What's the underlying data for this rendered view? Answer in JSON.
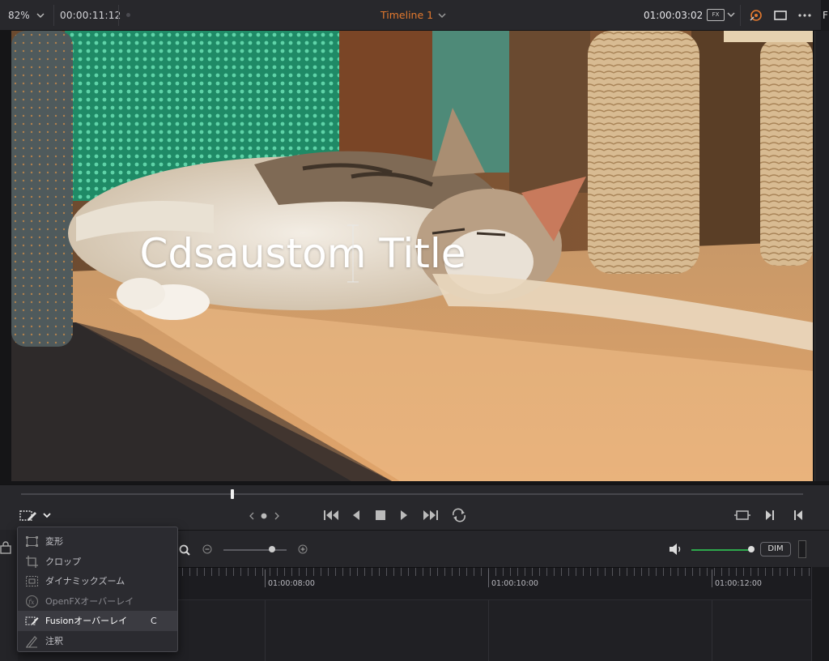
{
  "topbar": {
    "zoom": "82%",
    "source_timecode": "00:00:11:12",
    "timeline_name": "Timeline 1",
    "record_timecode": "01:00:03:02",
    "fx_label": "FX",
    "edge_label": "F"
  },
  "viewer": {
    "title_text": "Cdsaustom Title"
  },
  "transport": {
    "playhead_fraction": 0.27
  },
  "timeline_toolbar": {
    "dim_label": "DIM"
  },
  "ruler": {
    "labels": [
      "01:00:08:00",
      "01:00:10:00",
      "01:00:12:00"
    ]
  },
  "overlay_menu": {
    "items": [
      {
        "label": "変形",
        "icon": "transform-icon",
        "state": "normal",
        "shortcut": ""
      },
      {
        "label": "クロップ",
        "icon": "crop-icon",
        "state": "normal",
        "shortcut": ""
      },
      {
        "label": "ダイナミックズーム",
        "icon": "dynamic-zoom-icon",
        "state": "normal",
        "shortcut": ""
      },
      {
        "label": "OpenFXオーバーレイ",
        "icon": "openfx-icon",
        "state": "disabled",
        "shortcut": ""
      },
      {
        "label": "Fusionオーバーレイ",
        "icon": "fusion-overlay-icon",
        "state": "active",
        "shortcut": "C"
      },
      {
        "label": "注釈",
        "icon": "annotation-icon",
        "state": "normal",
        "shortcut": ""
      }
    ]
  },
  "colors": {
    "accent_orange": "#e3792e",
    "volume_green": "#2ea84c",
    "panel_bg": "#28282c"
  }
}
